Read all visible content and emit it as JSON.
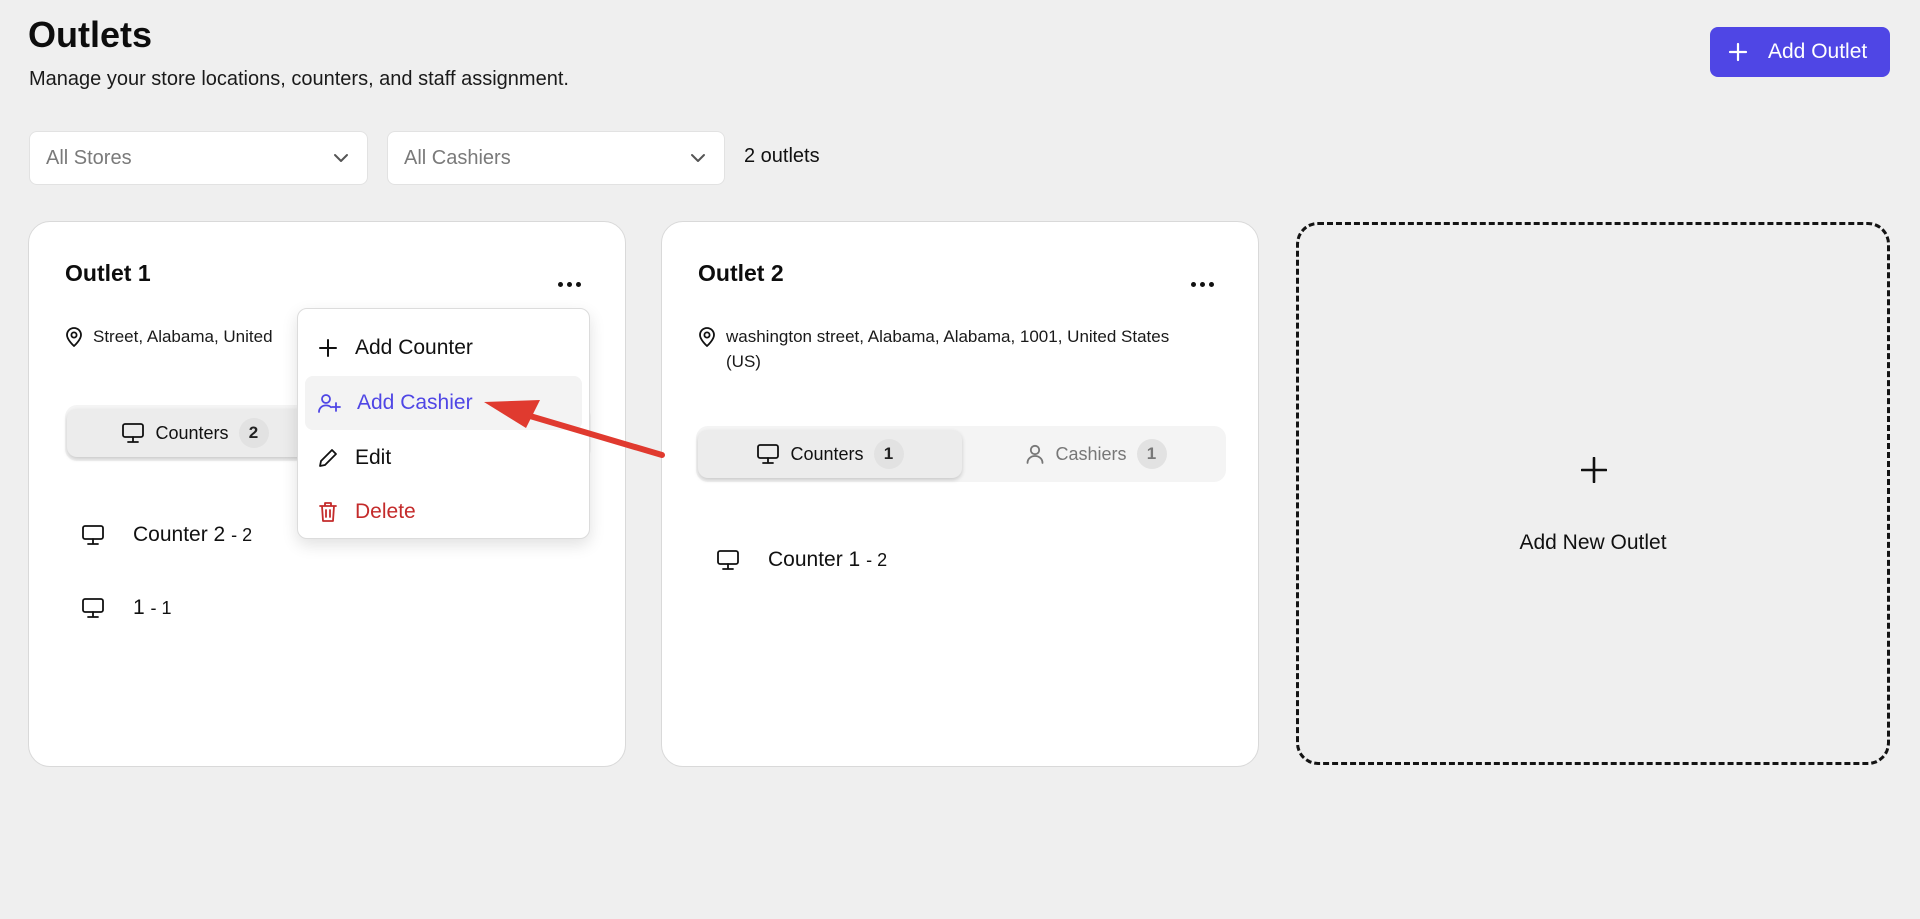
{
  "header": {
    "title": "Outlets",
    "subtitle": "Manage your store locations, counters, and staff assignment.",
    "add_button_label": "Add Outlet"
  },
  "filters": {
    "stores_value": "All Stores",
    "cashiers_value": "All Cashiers",
    "count_label": "2 outlets"
  },
  "outlets": [
    {
      "name": "Outlet 1",
      "address": "Street, Alabama, United",
      "tabs": {
        "counters_label": "Counters",
        "counters_count": "2"
      },
      "counters": [
        {
          "name": "Counter 2",
          "suffix": "- 2"
        },
        {
          "name": "1",
          "suffix": "- 1"
        }
      ]
    },
    {
      "name": "Outlet 2",
      "address": "washington street, Alabama, Alabama, 1001, United States (US)",
      "tabs": {
        "counters_label": "Counters",
        "counters_count": "1",
        "cashiers_label": "Cashiers",
        "cashiers_count": "1"
      },
      "counters": [
        {
          "name": "Counter 1",
          "suffix": "- 2"
        }
      ]
    }
  ],
  "add_new_card": {
    "label": "Add New Outlet"
  },
  "menu": {
    "items": [
      {
        "label": "Add Counter",
        "icon": "plus-icon"
      },
      {
        "label": "Add Cashier",
        "icon": "user-plus-icon"
      },
      {
        "label": "Edit",
        "icon": "pencil-icon"
      },
      {
        "label": "Delete",
        "icon": "trash-icon"
      }
    ]
  },
  "colors": {
    "accent": "#4f46e5",
    "danger": "#c42b2b",
    "annotation_arrow": "#e03a2f",
    "background": "#efefef"
  }
}
